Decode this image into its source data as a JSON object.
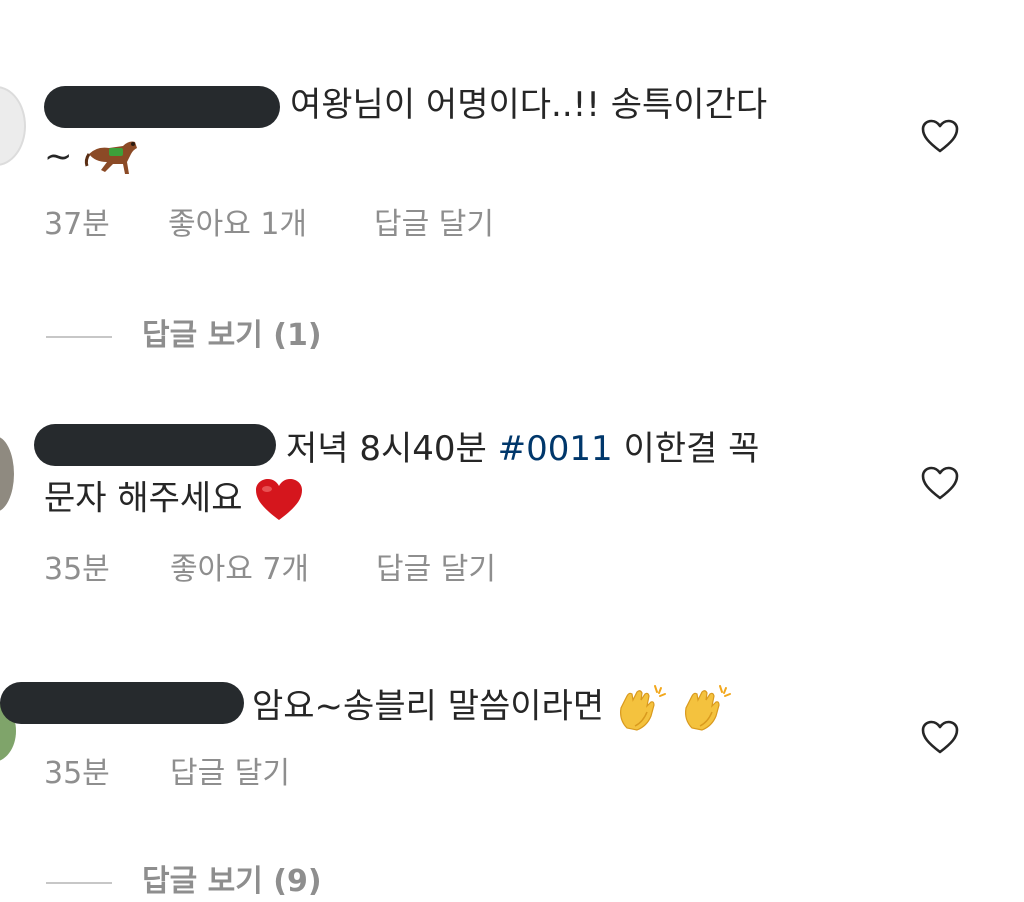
{
  "comments": [
    {
      "text": "여왕님이 어명이다..!! 송특이간다",
      "text_cont": "~",
      "emoji": "horse-racing-emoji",
      "time": "37분",
      "likes": "좋아요 1개",
      "reply": "답글 달기",
      "view_replies": "답글 보기 (1)"
    },
    {
      "text_pre": "저녁 8시40분 ",
      "hashtag": "#0011",
      "text_post": " 이한결 꼭",
      "text_cont": "문자 해주세요",
      "emoji": "red-heart-emoji",
      "time": "35분",
      "likes": "좋아요 7개",
      "reply": "답글 달기"
    },
    {
      "text": "암요~송블리 말씀이라면",
      "emoji": "clapping-hands-emoji",
      "time": "35분",
      "reply": "답글 달기",
      "view_replies": "답글 보기 (9)"
    }
  ],
  "colors": {
    "text": "#262626",
    "meta": "#8e8e8e",
    "hashtag": "#00376b",
    "redaction": "#262a2d"
  }
}
